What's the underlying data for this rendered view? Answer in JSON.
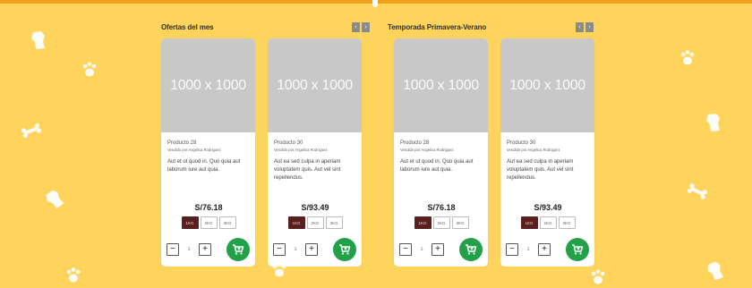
{
  "colors": {
    "background": "#fed45c",
    "top_bar": "#f1a21c",
    "cart_button": "#22a04a",
    "active_weight": "#5a1f1f",
    "image_placeholder": "#c8c8c8"
  },
  "sections": [
    {
      "title": "Ofertas del mes",
      "prev": "‹",
      "next": "›",
      "products": [
        {
          "image_text": "1000 x 1000",
          "name": "Producto 28",
          "seller": "Vendido por Angelica Rodriguez",
          "description": "Aut et ut quod in. Quo quia aut laborum iure aut quia.",
          "price": "S/76.18",
          "weights": [
            "1KG",
            "2KG",
            "3KG"
          ],
          "selected_weight": "1KG",
          "quantity": "1",
          "minus": "−",
          "plus": "+"
        },
        {
          "image_text": "1000 x 1000",
          "name": "Producto 30",
          "seller": "Vendido por Angelica Rodriguez",
          "description": "Aut ea sed culpa in aperiam voluptatem quis. Aut vel sint repellendus.",
          "price": "S/93.49",
          "weights": [
            "1KG",
            "2KG",
            "3KG"
          ],
          "selected_weight": "1KG",
          "quantity": "1",
          "minus": "−",
          "plus": "+"
        }
      ]
    },
    {
      "title": "Temporada Primavera-Verano",
      "prev": "‹",
      "next": "›",
      "products": [
        {
          "image_text": "1000 x 1000",
          "name": "Producto 28",
          "seller": "Vendido por Angelica Rodriguez",
          "description": "Aut et ut quod in. Quo quia aut laborum iure aut quia.",
          "price": "S/76.18",
          "weights": [
            "1KG",
            "2KG",
            "3KG"
          ],
          "selected_weight": "1KG",
          "quantity": "1",
          "minus": "−",
          "plus": "+"
        },
        {
          "image_text": "1000 x 1000",
          "name": "Producto 30",
          "seller": "Vendido por Angelica Rodriguez",
          "description": "Aut ea sed culpa in aperiam voluptatem quis. Aut vel sint repellendus.",
          "price": "S/93.49",
          "weights": [
            "1KG",
            "2KG",
            "3KG"
          ],
          "selected_weight": "1KG",
          "quantity": "1",
          "minus": "−",
          "plus": "+"
        }
      ]
    }
  ],
  "icons": {
    "cart": "cart-icon",
    "paw": "paw-icon",
    "bone": "bone-icon",
    "dog": "dog-icon"
  }
}
